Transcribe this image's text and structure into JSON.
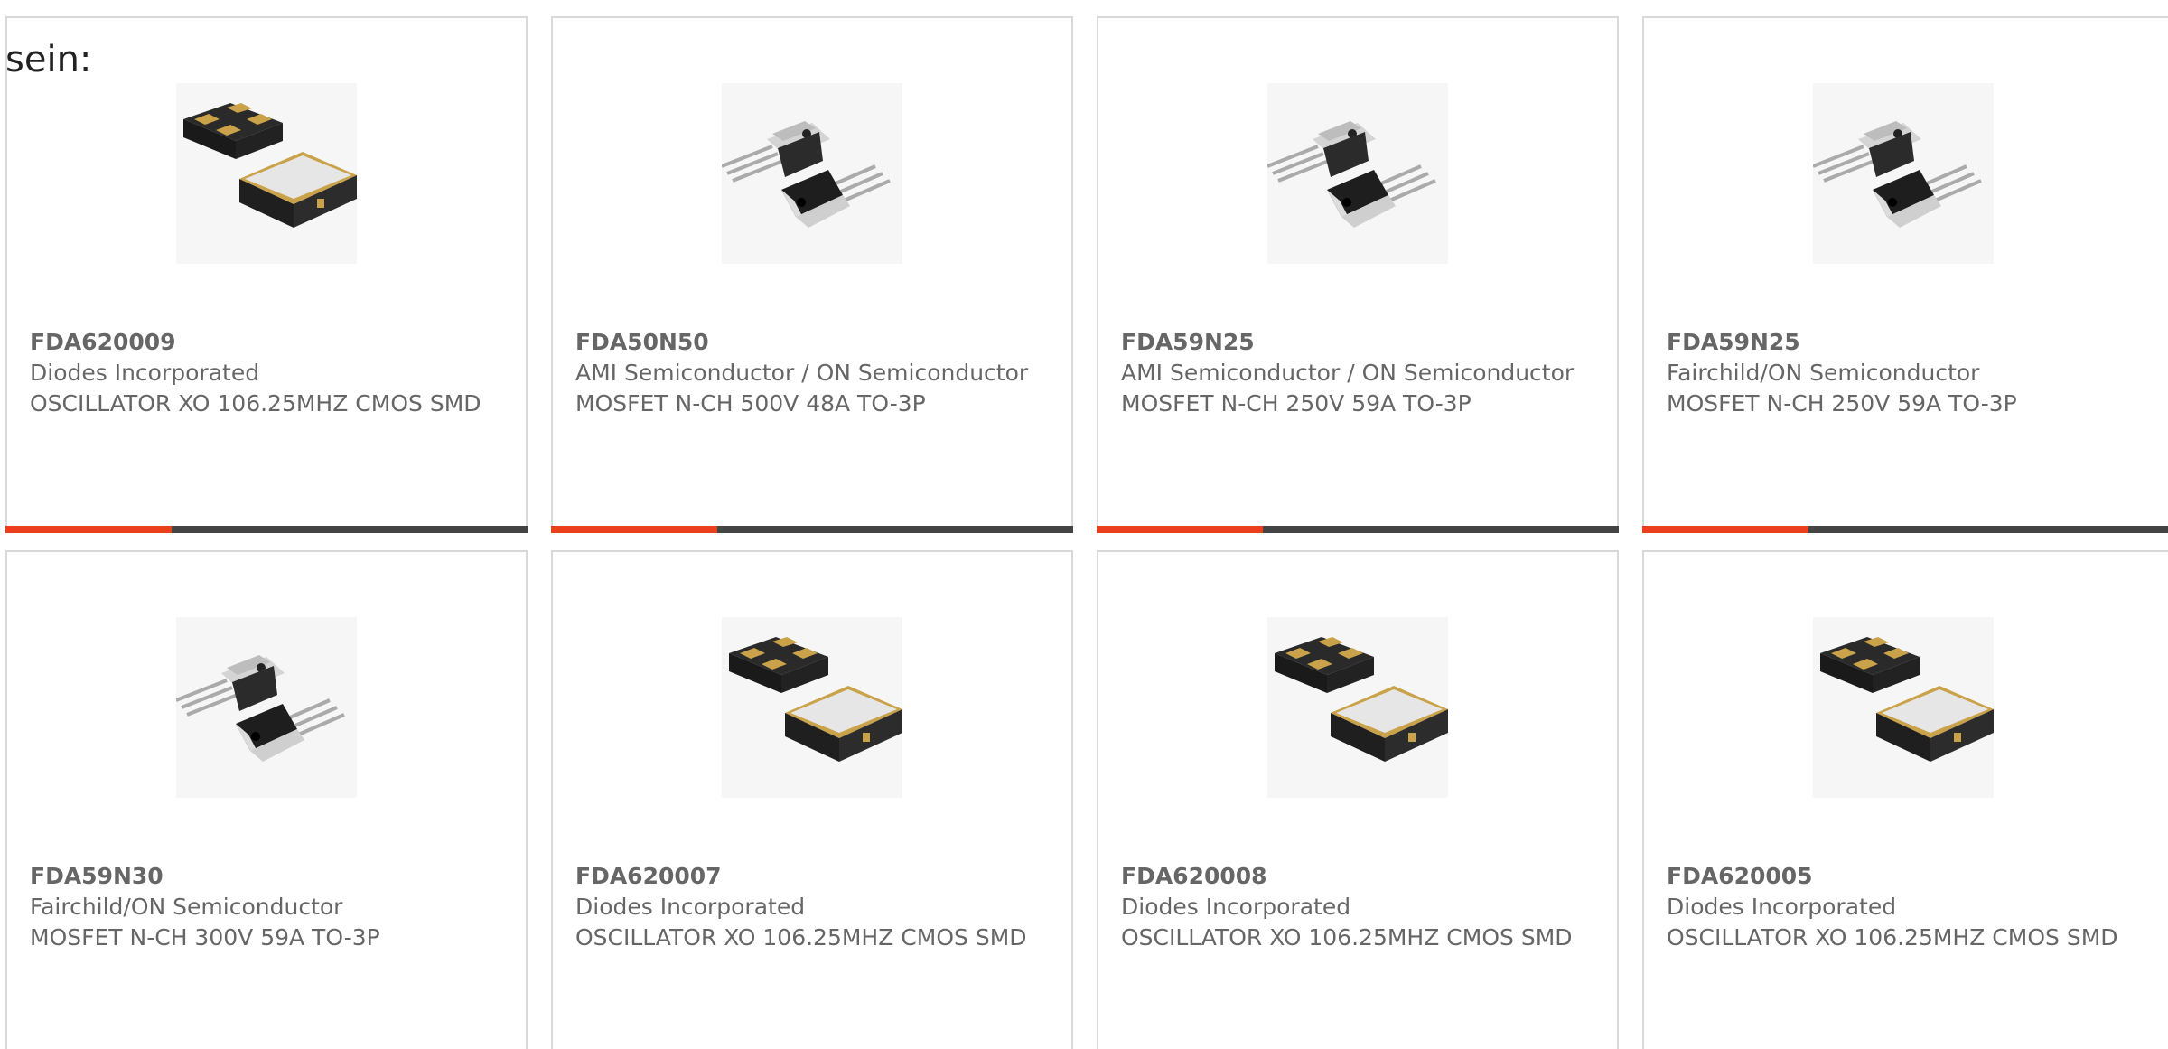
{
  "intro_text": "sein:",
  "colors": {
    "accent": "#e8401c",
    "bar": "#444444",
    "card_border": "#d9d9d9",
    "text": "#666666"
  },
  "products": [
    {
      "part_number": "FDA620009",
      "manufacturer": "Diodes Incorporated",
      "description": "OSCILLATOR XO 106.25MHZ CMOS SMD",
      "image": "oscillator-smd-icon"
    },
    {
      "part_number": "FDA50N50",
      "manufacturer": "AMI Semiconductor / ON Semiconductor",
      "description": "MOSFET N-CH 500V 48A TO-3P",
      "image": "to3p-transistor-icon"
    },
    {
      "part_number": "FDA59N25",
      "manufacturer": "AMI Semiconductor / ON Semiconductor",
      "description": "MOSFET N-CH 250V 59A TO-3P",
      "image": "to3p-transistor-icon"
    },
    {
      "part_number": "FDA59N25",
      "manufacturer": "Fairchild/ON Semiconductor",
      "description": "MOSFET N-CH 250V 59A TO-3P",
      "image": "to3p-transistor-icon"
    },
    {
      "part_number": "FDA59N30",
      "manufacturer": "Fairchild/ON Semiconductor",
      "description": "MOSFET N-CH 300V 59A TO-3P",
      "image": "to3p-transistor-icon"
    },
    {
      "part_number": "FDA620007",
      "manufacturer": "Diodes Incorporated",
      "description": "OSCILLATOR XO 106.25MHZ CMOS SMD",
      "image": "oscillator-smd-icon"
    },
    {
      "part_number": "FDA620008",
      "manufacturer": "Diodes Incorporated",
      "description": "OSCILLATOR XO 106.25MHZ CMOS SMD",
      "image": "oscillator-smd-icon"
    },
    {
      "part_number": "FDA620005",
      "manufacturer": "Diodes Incorporated",
      "description": "OSCILLATOR XO 106.25MHZ CMOS SMD",
      "image": "oscillator-smd-icon"
    }
  ]
}
